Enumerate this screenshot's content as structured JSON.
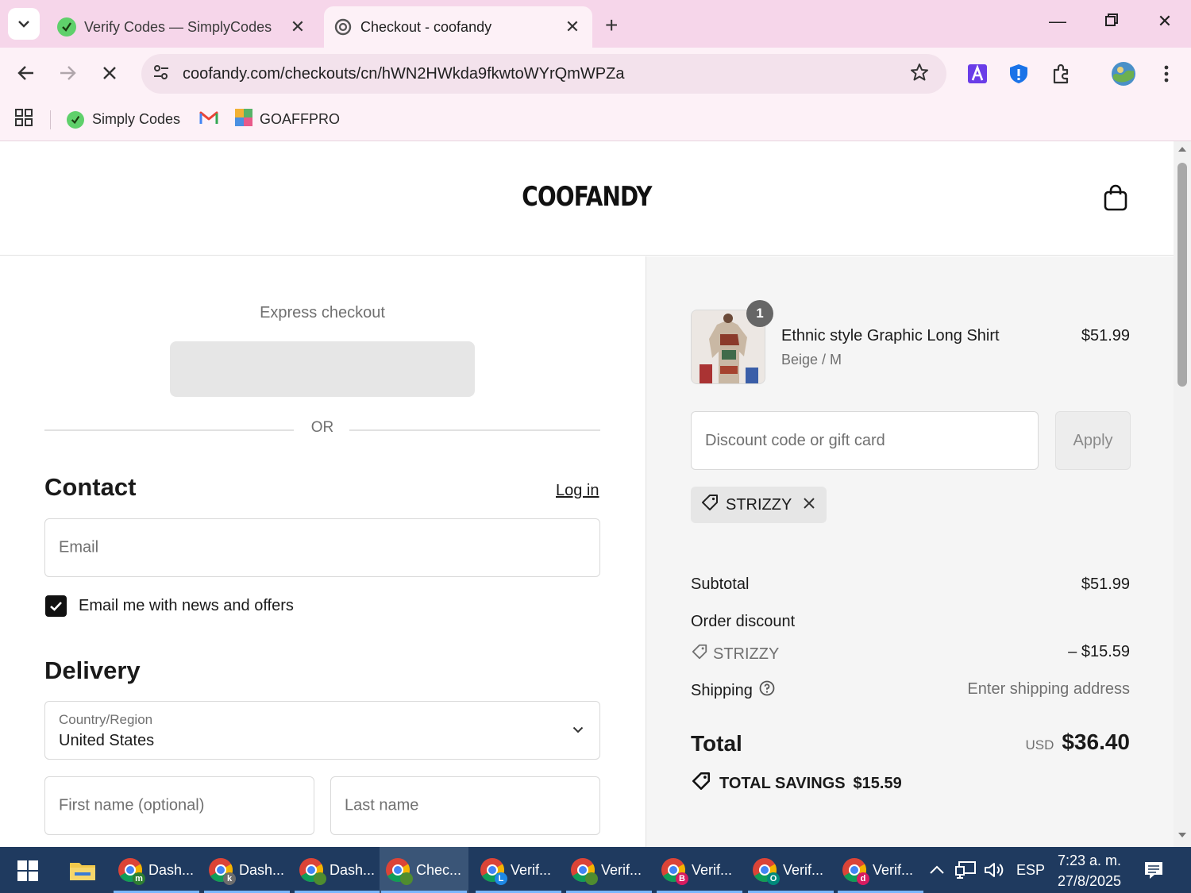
{
  "browser": {
    "tabs": [
      {
        "title": "Verify Codes — SimplyCodes",
        "active": false
      },
      {
        "title": "Checkout - coofandy",
        "active": true
      }
    ],
    "url": "coofandy.com/checkouts/cn/hWN2HWkda9fkwtoWYrQmWPZa",
    "bookmarks": [
      {
        "label": "Simply Codes"
      },
      {
        "label": ""
      },
      {
        "label": "GOAFFPRO"
      }
    ]
  },
  "store": {
    "logo": "COOFANDY"
  },
  "express": {
    "label": "Express checkout",
    "or": "OR"
  },
  "contact": {
    "heading": "Contact",
    "login": "Log in",
    "email_placeholder": "Email",
    "newsletter_label": "Email me with news and offers",
    "newsletter_checked": true
  },
  "delivery": {
    "heading": "Delivery",
    "country_label": "Country/Region",
    "country_value": "United States",
    "first_name_placeholder": "First name (optional)",
    "last_name_placeholder": "Last name"
  },
  "summary": {
    "item": {
      "name": "Ethnic style Graphic Long Shirt",
      "variant": "Beige / M",
      "price": "$51.99",
      "quantity": "1"
    },
    "discount_placeholder": "Discount code or gift card",
    "apply_label": "Apply",
    "applied_code": "STRIZZY",
    "subtotal_label": "Subtotal",
    "subtotal_value": "$51.99",
    "order_discount_label": "Order discount",
    "discount_code": "STRIZZY",
    "discount_value": "– $15.59",
    "shipping_label": "Shipping",
    "shipping_value": "Enter shipping address",
    "total_label": "Total",
    "currency": "USD",
    "total_value": "$36.40",
    "savings_label": "TOTAL SAVINGS",
    "savings_value": "$15.59"
  },
  "taskbar": {
    "items": [
      {
        "label": "Dash...",
        "badge": "m",
        "badge_color": "#2e7d32"
      },
      {
        "label": "Dash...",
        "badge": "k",
        "badge_color": "#6d6d6d"
      },
      {
        "label": "Dash...",
        "badge": "",
        "badge_color": "#4f8c2f"
      },
      {
        "label": "Chec...",
        "badge": "",
        "badge_color": "#4f8c2f"
      },
      {
        "label": "Verif...",
        "badge": "L",
        "badge_color": "#1e88e5"
      },
      {
        "label": "Verif...",
        "badge": "",
        "badge_color": "#4f8c2f"
      },
      {
        "label": "Verif...",
        "badge": "B",
        "badge_color": "#d81b60"
      },
      {
        "label": "Verif...",
        "badge": "O",
        "badge_color": "#00897b"
      },
      {
        "label": "Verif...",
        "badge": "d",
        "badge_color": "#d81b60"
      }
    ],
    "language": "ESP",
    "time": "7:23 a. m.",
    "date": "27/8/2025"
  }
}
